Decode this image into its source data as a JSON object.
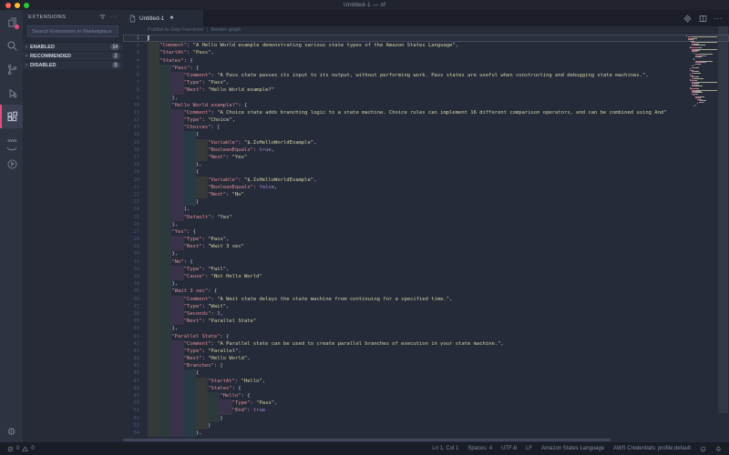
{
  "window": {
    "title": "Untitled-1 — sf"
  },
  "colors": {
    "accent_pink": "#e64c7f",
    "editor_bg": "#262b39",
    "key": "#e08e97",
    "string": "#d5d2a8",
    "constant": "#ac85d6",
    "punctuation": "#c3c8d6",
    "traffic_red": "#ff5f57",
    "traffic_yellow": "#febc2e",
    "traffic_green": "#28c840"
  },
  "icons": {
    "list": [
      "explorer-icon",
      "search-icon",
      "source-control-icon",
      "run-debug-icon",
      "extensions-icon",
      "aws-icon",
      "aws-tool-circle-icon",
      "gear-icon",
      "filter-icon",
      "more-icon",
      "file-icon",
      "render-graph-icon",
      "split-editor-icon",
      "error-icon",
      "warning-icon",
      "feedback-icon",
      "bell-icon"
    ],
    "gear": "⚙",
    "more": "···",
    "chevron": "›",
    "aws_label": "aws"
  },
  "sidebar": {
    "title": "EXTENSIONS",
    "search_placeholder": "Search Extensions in Marketplace",
    "sections": [
      {
        "label": "ENABLED",
        "count": "14"
      },
      {
        "label": "RECOMMENDED",
        "count": "2"
      },
      {
        "label": "DISABLED",
        "count": "0"
      }
    ]
  },
  "tab": {
    "label": "Untitled-1",
    "dirty_dot": "●"
  },
  "codelens": {
    "links": [
      "Publish to Step Functions",
      "Render graph"
    ],
    "separator": "|"
  },
  "status_bar": {
    "left": {
      "errors": "0",
      "warnings": "0"
    },
    "right": [
      "Ln 1, Col 1",
      "Spaces: 4",
      "UTF-8",
      "LF",
      "Amazon States Language",
      "AWS Credentials: profile:default"
    ]
  },
  "editor": {
    "lines": [
      {
        "i": 0,
        "t": [
          [
            "p",
            "{"
          ]
        ]
      },
      {
        "i": 1,
        "t": [
          [
            "k",
            "\"Comment\""
          ],
          [
            "p",
            ": "
          ],
          [
            "s",
            "\"A Hello World example demonstrating various state types of the Amazon States Language\""
          ],
          [
            "p",
            ","
          ]
        ]
      },
      {
        "i": 1,
        "t": [
          [
            "k",
            "\"StartAt\""
          ],
          [
            "p",
            ": "
          ],
          [
            "s",
            "\"Pass\""
          ],
          [
            "p",
            ","
          ]
        ]
      },
      {
        "i": 1,
        "t": [
          [
            "k",
            "\"States\""
          ],
          [
            "p",
            ": {"
          ]
        ]
      },
      {
        "i": 2,
        "t": [
          [
            "k",
            "\"Pass\""
          ],
          [
            "p",
            ": {"
          ]
        ]
      },
      {
        "i": 3,
        "t": [
          [
            "k",
            "\"Comment\""
          ],
          [
            "p",
            ": "
          ],
          [
            "s",
            "\"A Pass state passes its input to its output, without performing work. Pass states are useful when constructing and debugging state machines.\""
          ],
          [
            "p",
            ","
          ]
        ]
      },
      {
        "i": 3,
        "t": [
          [
            "k",
            "\"Type\""
          ],
          [
            "p",
            ": "
          ],
          [
            "s",
            "\"Pass\""
          ],
          [
            "p",
            ","
          ]
        ]
      },
      {
        "i": 3,
        "t": [
          [
            "k",
            "\"Next\""
          ],
          [
            "p",
            ": "
          ],
          [
            "s",
            "\"Hello World example?\""
          ]
        ]
      },
      {
        "i": 2,
        "t": [
          [
            "p",
            "},"
          ]
        ]
      },
      {
        "i": 2,
        "t": [
          [
            "k",
            "\"Hello World example?\""
          ],
          [
            "p",
            ": {"
          ]
        ]
      },
      {
        "i": 3,
        "t": [
          [
            "k",
            "\"Comment\""
          ],
          [
            "p",
            ": "
          ],
          [
            "s",
            "\"A Choice state adds branching logic to a state machine. Choice rules can implement 16 different comparison operators, and can be combined using And\""
          ]
        ]
      },
      {
        "i": 3,
        "t": [
          [
            "k",
            "\"Type\""
          ],
          [
            "p",
            ": "
          ],
          [
            "s",
            "\"Choice\""
          ],
          [
            "p",
            ","
          ]
        ]
      },
      {
        "i": 3,
        "t": [
          [
            "k",
            "\"Choices\""
          ],
          [
            "p",
            ": ["
          ]
        ]
      },
      {
        "i": 4,
        "t": [
          [
            "p",
            "{"
          ]
        ]
      },
      {
        "i": 5,
        "t": [
          [
            "k",
            "\"Variable\""
          ],
          [
            "p",
            ": "
          ],
          [
            "s",
            "\"$.IsHelloWorldExample\""
          ],
          [
            "p",
            ","
          ]
        ]
      },
      {
        "i": 5,
        "t": [
          [
            "k",
            "\"BooleanEquals\""
          ],
          [
            "p",
            ": "
          ],
          [
            "b",
            "true"
          ],
          [
            "p",
            ","
          ]
        ]
      },
      {
        "i": 5,
        "t": [
          [
            "k",
            "\"Next\""
          ],
          [
            "p",
            ": "
          ],
          [
            "s",
            "\"Yes\""
          ]
        ]
      },
      {
        "i": 4,
        "t": [
          [
            "p",
            "},"
          ]
        ]
      },
      {
        "i": 4,
        "t": [
          [
            "p",
            "{"
          ]
        ]
      },
      {
        "i": 5,
        "t": [
          [
            "k",
            "\"Variable\""
          ],
          [
            "p",
            ": "
          ],
          [
            "s",
            "\"$.IsHelloWorldExample\""
          ],
          [
            "p",
            ","
          ]
        ]
      },
      {
        "i": 5,
        "t": [
          [
            "k",
            "\"BooleanEquals\""
          ],
          [
            "p",
            ": "
          ],
          [
            "b",
            "false"
          ],
          [
            "p",
            ","
          ]
        ]
      },
      {
        "i": 5,
        "t": [
          [
            "k",
            "\"Next\""
          ],
          [
            "p",
            ": "
          ],
          [
            "s",
            "\"No\""
          ]
        ]
      },
      {
        "i": 4,
        "t": [
          [
            "p",
            "}"
          ]
        ]
      },
      {
        "i": 3,
        "t": [
          [
            "p",
            "],"
          ]
        ]
      },
      {
        "i": 3,
        "t": [
          [
            "k",
            "\"Default\""
          ],
          [
            "p",
            ": "
          ],
          [
            "s",
            "\"Yes\""
          ]
        ]
      },
      {
        "i": 2,
        "t": [
          [
            "p",
            "},"
          ]
        ]
      },
      {
        "i": 2,
        "t": [
          [
            "k",
            "\"Yes\""
          ],
          [
            "p",
            ": {"
          ]
        ]
      },
      {
        "i": 3,
        "t": [
          [
            "k",
            "\"Type\""
          ],
          [
            "p",
            ": "
          ],
          [
            "s",
            "\"Pass\""
          ],
          [
            "p",
            ","
          ]
        ]
      },
      {
        "i": 3,
        "t": [
          [
            "k",
            "\"Next\""
          ],
          [
            "p",
            ": "
          ],
          [
            "s",
            "\"Wait 3 sec\""
          ]
        ]
      },
      {
        "i": 2,
        "t": [
          [
            "p",
            "},"
          ]
        ]
      },
      {
        "i": 2,
        "t": [
          [
            "k",
            "\"No\""
          ],
          [
            "p",
            ": {"
          ]
        ]
      },
      {
        "i": 3,
        "t": [
          [
            "k",
            "\"Type\""
          ],
          [
            "p",
            ": "
          ],
          [
            "s",
            "\"Fail\""
          ],
          [
            "p",
            ","
          ]
        ]
      },
      {
        "i": 3,
        "t": [
          [
            "k",
            "\"Cause\""
          ],
          [
            "p",
            ": "
          ],
          [
            "s",
            "\"Not Hello World\""
          ]
        ]
      },
      {
        "i": 2,
        "t": [
          [
            "p",
            "},"
          ]
        ]
      },
      {
        "i": 2,
        "t": [
          [
            "k",
            "\"Wait 3 sec\""
          ],
          [
            "p",
            ": {"
          ]
        ]
      },
      {
        "i": 3,
        "t": [
          [
            "k",
            "\"Comment\""
          ],
          [
            "p",
            ": "
          ],
          [
            "s",
            "\"A Wait state delays the state machine from continuing for a specified time.\""
          ],
          [
            "p",
            ","
          ]
        ]
      },
      {
        "i": 3,
        "t": [
          [
            "k",
            "\"Type\""
          ],
          [
            "p",
            ": "
          ],
          [
            "s",
            "\"Wait\""
          ],
          [
            "p",
            ","
          ]
        ]
      },
      {
        "i": 3,
        "t": [
          [
            "k",
            "\"Seconds\""
          ],
          [
            "p",
            ": "
          ],
          [
            "b",
            "3"
          ],
          [
            "p",
            ","
          ]
        ]
      },
      {
        "i": 3,
        "t": [
          [
            "k",
            "\"Next\""
          ],
          [
            "p",
            ": "
          ],
          [
            "s",
            "\"Parallel State\""
          ]
        ]
      },
      {
        "i": 2,
        "t": [
          [
            "p",
            "},"
          ]
        ]
      },
      {
        "i": 2,
        "t": [
          [
            "k",
            "\"Parallel State\""
          ],
          [
            "p",
            ": {"
          ]
        ]
      },
      {
        "i": 3,
        "t": [
          [
            "k",
            "\"Comment\""
          ],
          [
            "p",
            ": "
          ],
          [
            "s",
            "\"A Parallel state can be used to create parallel branches of execution in your state machine.\""
          ],
          [
            "p",
            ","
          ]
        ]
      },
      {
        "i": 3,
        "t": [
          [
            "k",
            "\"Type\""
          ],
          [
            "p",
            ": "
          ],
          [
            "s",
            "\"Parallel\""
          ],
          [
            "p",
            ","
          ]
        ]
      },
      {
        "i": 3,
        "t": [
          [
            "k",
            "\"Next\""
          ],
          [
            "p",
            ": "
          ],
          [
            "s",
            "\"Hello World\""
          ],
          [
            "p",
            ","
          ]
        ]
      },
      {
        "i": 3,
        "t": [
          [
            "k",
            "\"Branches\""
          ],
          [
            "p",
            ": ["
          ]
        ]
      },
      {
        "i": 4,
        "t": [
          [
            "p",
            "{"
          ]
        ]
      },
      {
        "i": 5,
        "t": [
          [
            "k",
            "\"StartAt\""
          ],
          [
            "p",
            ": "
          ],
          [
            "s",
            "\"Hello\""
          ],
          [
            "p",
            ","
          ]
        ]
      },
      {
        "i": 5,
        "t": [
          [
            "k",
            "\"States\""
          ],
          [
            "p",
            ": {"
          ]
        ]
      },
      {
        "i": 6,
        "t": [
          [
            "k",
            "\"Hello\""
          ],
          [
            "p",
            ": {"
          ]
        ]
      },
      {
        "i": 7,
        "t": [
          [
            "k",
            "\"Type\""
          ],
          [
            "p",
            ": "
          ],
          [
            "s",
            "\"Pass\""
          ],
          [
            "p",
            ","
          ]
        ]
      },
      {
        "i": 7,
        "t": [
          [
            "k",
            "\"End\""
          ],
          [
            "p",
            ": "
          ],
          [
            "b",
            "true"
          ]
        ]
      },
      {
        "i": 6,
        "t": [
          [
            "p",
            "}"
          ]
        ]
      },
      {
        "i": 5,
        "t": [
          [
            "p",
            "}"
          ]
        ]
      },
      {
        "i": 4,
        "t": [
          [
            "p",
            "},"
          ]
        ]
      }
    ]
  }
}
